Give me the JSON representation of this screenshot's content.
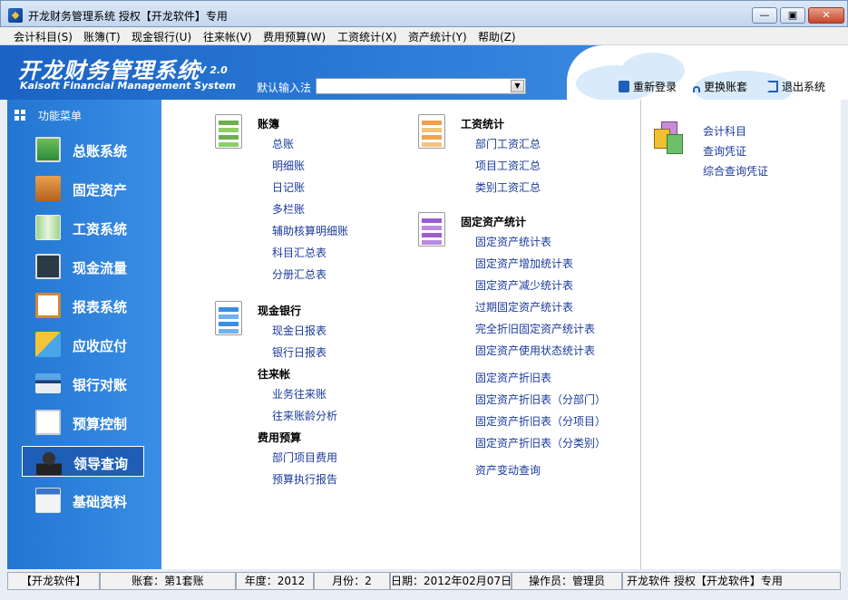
{
  "window": {
    "title": "开龙财务管理系统 授权【开龙软件】专用"
  },
  "menu": [
    "会计科目(S)",
    "账簿(T)",
    "现金银行(U)",
    "往来帐(V)",
    "费用预算(W)",
    "工资统计(X)",
    "资产统计(Y)",
    "帮助(Z)"
  ],
  "banner": {
    "brand": "开龙财务管理系统",
    "version": "V 2.0",
    "brand_en": "Kaisoft Financial Management System",
    "ime_label": "默认输入法",
    "ime_value": "",
    "actions": [
      "重新登录",
      "更换账套",
      "退出系统"
    ]
  },
  "sidebar": {
    "header": "功能菜单",
    "items": [
      {
        "label": "总账系统",
        "icon": "ledger-icon"
      },
      {
        "label": "固定资产",
        "icon": "cabinet-icon"
      },
      {
        "label": "工资系统",
        "icon": "salary-icon"
      },
      {
        "label": "现金流量",
        "icon": "cashflow-icon"
      },
      {
        "label": "报表系统",
        "icon": "clipboard-icon"
      },
      {
        "label": "应收应付",
        "icon": "receivable-icon"
      },
      {
        "label": "银行对账",
        "icon": "bank-card-icon"
      },
      {
        "label": "预算控制",
        "icon": "budget-chart-icon"
      },
      {
        "label": "领导查询",
        "icon": "leader-query-icon",
        "active": true
      },
      {
        "label": "基础资料",
        "icon": "base-data-icon"
      }
    ]
  },
  "main": {
    "ledger": {
      "title": "账簿",
      "links": [
        "总账",
        "明细账",
        "日记账",
        "多栏账",
        "辅助核算明细账",
        "科目汇总表",
        "分册汇总表"
      ]
    },
    "cash": {
      "title": "现金银行",
      "links": [
        "现金日报表",
        "银行日报表"
      ]
    },
    "arap": {
      "title": "往来帐",
      "links": [
        "业务往来账",
        "往来账龄分析"
      ]
    },
    "expense": {
      "title": "费用预算",
      "links": [
        "部门项目费用",
        "预算执行报告"
      ]
    },
    "salary": {
      "title": "工资统计",
      "links": [
        "部门工资汇总",
        "项目工资汇总",
        "类别工资汇总"
      ]
    },
    "assets": {
      "title": "固定资产统计",
      "links": [
        "固定资产统计表",
        "固定资产增加统计表",
        "固定资产减少统计表",
        "过期固定资产统计表",
        "完全折旧固定资产统计表",
        "固定资产使用状态统计表"
      ],
      "links2": [
        "固定资产折旧表",
        "固定资产折旧表（分部门）",
        "固定资产折旧表（分项目）",
        "固定资产折旧表（分类别）"
      ],
      "links3": [
        "资产变动查询"
      ]
    }
  },
  "right": {
    "links": [
      "会计科目",
      "查询凭证",
      "综合查询凭证"
    ]
  },
  "status": [
    "【开龙软件】",
    "账套：第1套账",
    "年度：2012",
    "月份：2",
    "日期：2012年02月07日",
    "操作员：管理员",
    "开龙软件 授权【开龙软件】专用"
  ],
  "colors": {
    "accent": "#2a7fd9",
    "link": "#1a3a9c"
  }
}
